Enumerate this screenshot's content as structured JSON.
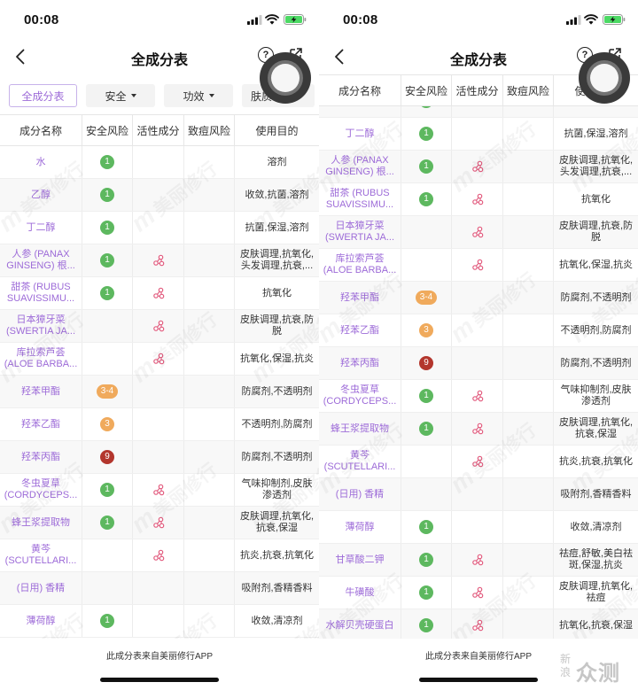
{
  "status_bar": {
    "time": "00:08"
  },
  "icons": {
    "back": "chevron-left-icon",
    "help": "help-circle-icon",
    "share": "share-icon",
    "signal": "cellular-signal-icon",
    "wifi": "wifi-icon",
    "battery": "battery-charging-icon",
    "assistive": "assistive-touch-icon",
    "active": "active-ingredient-icon",
    "dropdown": "caret-down-icon"
  },
  "nav": {
    "title": "全成分表",
    "help_glyph": "?"
  },
  "filters": [
    {
      "label": "全成分表",
      "selected": true
    },
    {
      "label": "安全",
      "dropdown": true
    },
    {
      "label": "功效",
      "dropdown": true
    },
    {
      "label": "肤质匹配"
    }
  ],
  "columns": [
    "成分名称",
    "安全风险",
    "活性成分",
    "致痘风险",
    "使用目的"
  ],
  "colors": {
    "ingredient_name": "#9d6bd8",
    "filter_selected": "#9d6bd8",
    "active_icon": "#e25b7e",
    "safety_low": "#5db85f",
    "safety_mid": "#f0aa5c",
    "safety_high": "#b3362d",
    "battery": "#4cd964"
  },
  "panels": [
    {
      "rows": [
        {
          "name": "水",
          "safety": {
            "score": "1",
            "level": "low"
          },
          "active": false,
          "purpose": "溶剂"
        },
        {
          "name": "乙醇",
          "safety": {
            "score": "1",
            "level": "low"
          },
          "active": false,
          "purpose": "收敛,抗菌,溶剂"
        },
        {
          "name": "丁二醇",
          "safety": {
            "score": "1",
            "level": "low"
          },
          "active": false,
          "purpose": "抗菌,保湿,溶剂"
        },
        {
          "name": "人参 (PANAX GINSENG) 根...",
          "safety": {
            "score": "1",
            "level": "low"
          },
          "active": true,
          "purpose": "皮肤调理,抗氧化,头发调理,抗衰,..."
        },
        {
          "name": "甜茶 (RUBUS SUAVISSIMU...",
          "safety": {
            "score": "1",
            "level": "low"
          },
          "active": true,
          "purpose": "抗氧化"
        },
        {
          "name": "日本獐牙菜 (SWERTIA JA...",
          "safety": null,
          "active": true,
          "purpose": "皮肤调理,抗衰,防脱"
        },
        {
          "name": "库拉索芦荟 (ALOE BARBA...",
          "safety": null,
          "active": true,
          "purpose": "抗氧化,保湿,抗炎"
        },
        {
          "name": "羟苯甲酯",
          "safety": {
            "score": "3-4",
            "level": "mid"
          },
          "active": false,
          "purpose": "防腐剂,不透明剂"
        },
        {
          "name": "羟苯乙酯",
          "safety": {
            "score": "3",
            "level": "mid"
          },
          "active": false,
          "purpose": "不透明剂,防腐剂"
        },
        {
          "name": "羟苯丙酯",
          "safety": {
            "score": "9",
            "level": "high"
          },
          "active": false,
          "purpose": "防腐剂,不透明剂"
        },
        {
          "name": "冬虫夏草 (CORDYCEPS...",
          "safety": {
            "score": "1",
            "level": "low"
          },
          "active": true,
          "purpose": "气味抑制剂,皮肤渗透剂"
        },
        {
          "name": "蜂王浆提取物",
          "safety": {
            "score": "1",
            "level": "low"
          },
          "active": true,
          "purpose": "皮肤调理,抗氧化,抗衰,保湿"
        },
        {
          "name": "黄芩 (SCUTELLARI...",
          "safety": null,
          "active": true,
          "purpose": "抗炎,抗衰,抗氧化"
        },
        {
          "name": "(日用) 香精",
          "safety": null,
          "active": false,
          "purpose": "吸附剂,香精香料"
        },
        {
          "name": "薄荷醇",
          "safety": {
            "score": "1",
            "level": "low"
          },
          "active": false,
          "purpose": "收敛,清凉剂"
        }
      ]
    },
    {
      "rows": [
        {
          "name": "",
          "safety": {
            "score": "",
            "level": "low"
          },
          "active": false,
          "purpose": ""
        },
        {
          "name": "丁二醇",
          "safety": {
            "score": "1",
            "level": "low"
          },
          "active": false,
          "purpose": "抗菌,保湿,溶剂"
        },
        {
          "name": "人参 (PANAX GINSENG) 根...",
          "safety": {
            "score": "1",
            "level": "low"
          },
          "active": true,
          "purpose": "皮肤调理,抗氧化,头发调理,抗衰,..."
        },
        {
          "name": "甜茶 (RUBUS SUAVISSIMU...",
          "safety": {
            "score": "1",
            "level": "low"
          },
          "active": true,
          "purpose": "抗氧化"
        },
        {
          "name": "日本獐牙菜 (SWERTIA JA...",
          "safety": null,
          "active": true,
          "purpose": "皮肤调理,抗衰,防脱"
        },
        {
          "name": "库拉索芦荟 (ALOE BARBA...",
          "safety": null,
          "active": true,
          "purpose": "抗氧化,保湿,抗炎"
        },
        {
          "name": "羟苯甲酯",
          "safety": {
            "score": "3-4",
            "level": "mid"
          },
          "active": false,
          "purpose": "防腐剂,不透明剂"
        },
        {
          "name": "羟苯乙酯",
          "safety": {
            "score": "3",
            "level": "mid"
          },
          "active": false,
          "purpose": "不透明剂,防腐剂"
        },
        {
          "name": "羟苯丙酯",
          "safety": {
            "score": "9",
            "level": "high"
          },
          "active": false,
          "purpose": "防腐剂,不透明剂"
        },
        {
          "name": "冬虫夏草 (CORDYCEPS...",
          "safety": {
            "score": "1",
            "level": "low"
          },
          "active": true,
          "purpose": "气味抑制剂,皮肤渗透剂"
        },
        {
          "name": "蜂王浆提取物",
          "safety": {
            "score": "1",
            "level": "low"
          },
          "active": true,
          "purpose": "皮肤调理,抗氧化,抗衰,保湿"
        },
        {
          "name": "黄芩 (SCUTELLARI...",
          "safety": null,
          "active": true,
          "purpose": "抗炎,抗衰,抗氧化"
        },
        {
          "name": "(日用) 香精",
          "safety": null,
          "active": false,
          "purpose": "吸附剂,香精香料"
        },
        {
          "name": "薄荷醇",
          "safety": {
            "score": "1",
            "level": "low"
          },
          "active": false,
          "purpose": "收敛,清凉剂"
        },
        {
          "name": "甘草酸二钾",
          "safety": {
            "score": "1",
            "level": "low"
          },
          "active": true,
          "purpose": "祛痘,舒敏,美白祛斑,保湿,抗炎"
        },
        {
          "name": "牛磺酸",
          "safety": {
            "score": "1",
            "level": "low"
          },
          "active": true,
          "purpose": "皮肤调理,抗氧化,祛痘"
        },
        {
          "name": "水解贝壳硬蛋白",
          "safety": {
            "score": "1",
            "level": "low"
          },
          "active": true,
          "purpose": "抗氧化,抗衰,保湿"
        }
      ]
    }
  ],
  "footer": {
    "source_note": "此成分表来自美丽修行APP"
  },
  "background_watermark": {
    "logo_letter": "m",
    "text": "美丽修行"
  },
  "corner_watermark": {
    "part1": "新浪",
    "part2": "众测"
  }
}
